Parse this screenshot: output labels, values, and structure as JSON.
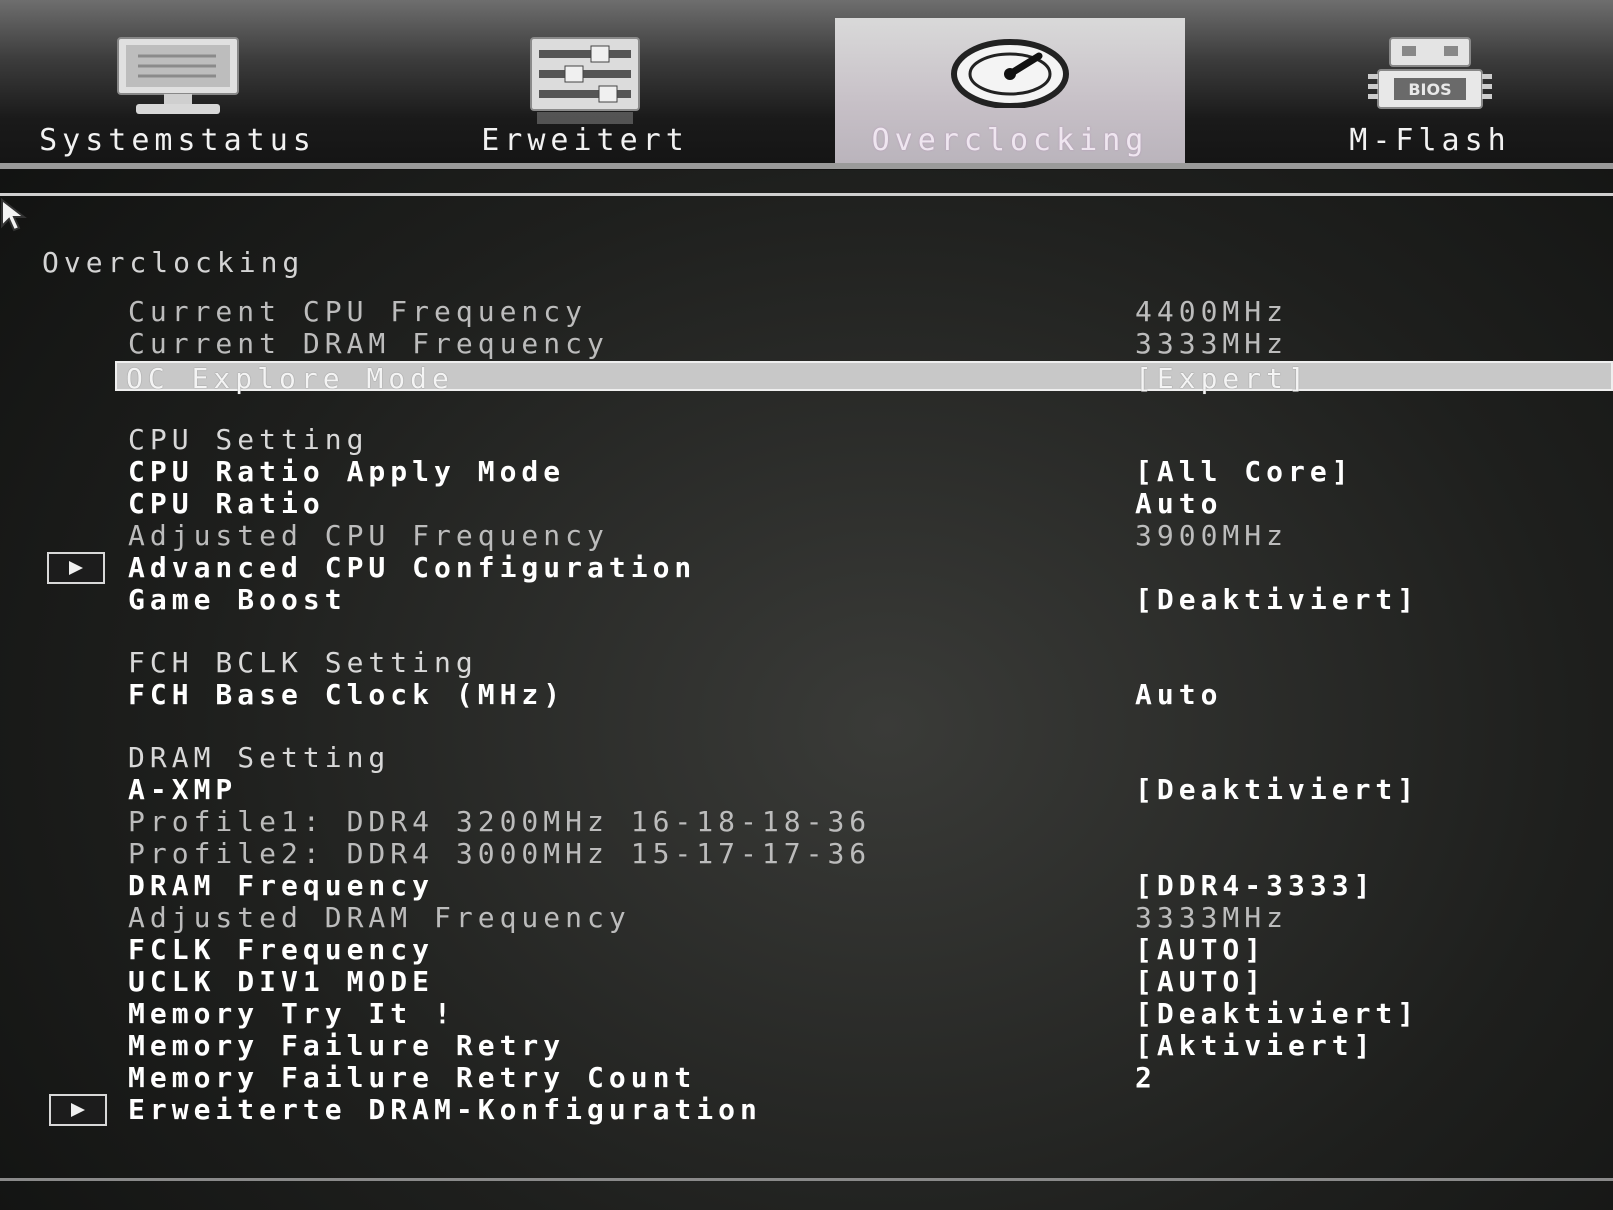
{
  "tabs": [
    {
      "label": "Systemstatus",
      "icon": "monitor-icon"
    },
    {
      "label": "Erweitert",
      "icon": "sliders-icon"
    },
    {
      "label": "Overclocking",
      "icon": "speedometer-icon",
      "active": true
    },
    {
      "label": "M-Flash",
      "icon": "bios-chip-icon",
      "chip_text": "BIOS"
    }
  ],
  "section_title": "Overclocking",
  "rows": {
    "cur_cpu": {
      "label": "Current CPU Frequency",
      "value": "4400MHz"
    },
    "cur_dram": {
      "label": "Current DRAM Frequency",
      "value": "3333MHz"
    },
    "oc_mode": {
      "label": "OC Explore Mode",
      "value": "[Expert]"
    },
    "cpu_setting": {
      "label": "CPU Setting"
    },
    "cpu_ratio_mode": {
      "label": "CPU Ratio Apply Mode",
      "value": "[All Core]"
    },
    "cpu_ratio": {
      "label": "CPU Ratio",
      "value": "Auto"
    },
    "adj_cpu": {
      "label": "Adjusted CPU Frequency",
      "value": "3900MHz"
    },
    "adv_cpu": {
      "label": "Advanced CPU Configuration"
    },
    "game_boost": {
      "label": "Game Boost",
      "value": "[Deaktiviert]"
    },
    "fch_setting": {
      "label": "FCH BCLK Setting"
    },
    "fch_clock": {
      "label": "FCH Base Clock (MHz)",
      "value": "Auto"
    },
    "dram_setting": {
      "label": "DRAM Setting"
    },
    "axmp": {
      "label": "A-XMP",
      "value": "[Deaktiviert]"
    },
    "profile1": {
      "label": "Profile1: DDR4 3200MHz 16-18-18-36"
    },
    "profile2": {
      "label": "Profile2: DDR4 3000MHz 15-17-17-36"
    },
    "dram_freq": {
      "label": "DRAM Frequency",
      "value": "[DDR4-3333]"
    },
    "adj_dram": {
      "label": "Adjusted DRAM Frequency",
      "value": "3333MHz"
    },
    "fclk": {
      "label": "FCLK Frequency",
      "value": "[AUTO]"
    },
    "uclk": {
      "label": "UCLK DIV1 MODE",
      "value": "[AUTO]"
    },
    "mem_try": {
      "label": "Memory Try It !",
      "value": "[Deaktiviert]"
    },
    "mem_retry": {
      "label": "Memory Failure Retry",
      "value": "[Aktiviert]"
    },
    "mem_retry_count": {
      "label": "Memory Failure Retry Count",
      "value": "2"
    },
    "adv_dram": {
      "label": "Erweiterte DRAM-Konfiguration"
    }
  }
}
